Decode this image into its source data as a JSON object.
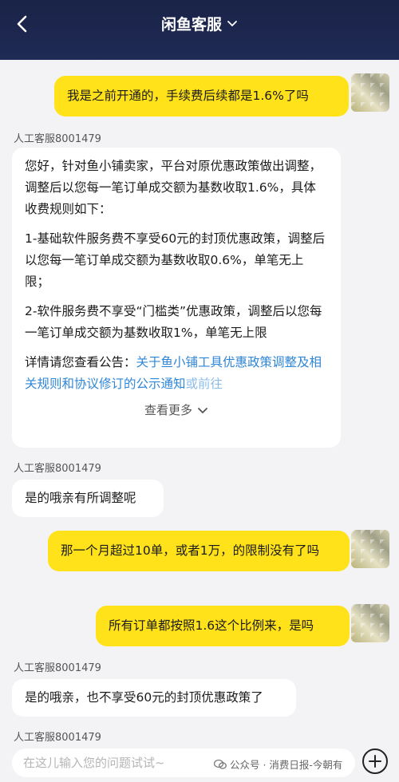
{
  "header": {
    "title": "闲鱼客服",
    "back_icon": "chevron-left-icon",
    "title_dropdown_icon": "chevron-down-icon"
  },
  "messages": {
    "user1": "我是之前开通的，手续费后续都是1.6%了吗",
    "agent1_name": "人工客服8001479",
    "agent1_p1": "您好，针对鱼小铺卖家，平台对原优惠政策做出调整，调整后以您每一笔订单成交额为基数收取1.6%，具体收费规则如下：",
    "agent1_p2": "1-基础软件服务费不享受60元的封顶优惠政策，调整后以您每一笔订单成交额为基数收取0.6%，单笔无上限；",
    "agent1_p3": "2-软件服务费不享受“门槛类”优惠政策，调整后以您每一笔订单成交额为基数收取1%，单笔无上限",
    "agent1_p4_prefix": "详情请您查看公告：",
    "agent1_p4_link": "关于鱼小铺工具优惠政策调整及相关规则和协议修订的公示通知",
    "agent1_p4_suffix": "或前往",
    "agent1_view_more": "查看更多",
    "agent2_name": "人工客服8001479",
    "agent2_text": "是的哦亲有所调整呢",
    "user2": "那一个月超过10单，或者1万，的限制没有了吗",
    "user3": "所有订单都按照1.6这个比例来，是吗",
    "agent3_name": "人工客服8001479",
    "agent3_text": "是的哦亲，也不享受60元的封顶优惠政策了",
    "agent4_name": "人工客服8001479"
  },
  "input": {
    "placeholder": "在这儿输入您的问题试试~"
  },
  "watermark": {
    "text": "公众号 · 消费日报-今朝有"
  },
  "colors": {
    "header_bg": "#1f2a55",
    "user_bubble": "#ffe21a",
    "link": "#2f86d6"
  }
}
